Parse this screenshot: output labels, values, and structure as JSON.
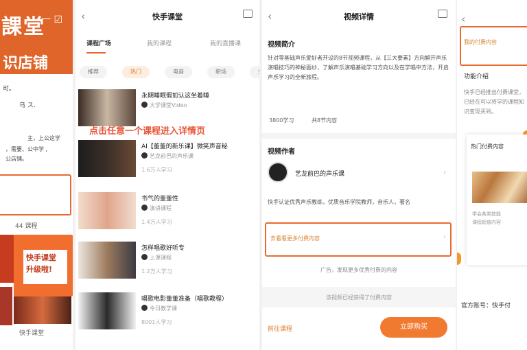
{
  "panel1": {
    "banner_title": "課堂",
    "banner_subtitle": "识店铺",
    "top_icons": "一 ☑",
    "text_lines": [
      "可。",
      "乌 ス.",
      "主，上公这学",
      "，需要、公中学 ,",
      "公店铺。"
    ],
    "count": "44 课程",
    "promo_text": "快手课堂\n升级啦!",
    "footer": "快手课堂"
  },
  "panel2": {
    "title": "快手课堂",
    "back": "‹",
    "tabs": [
      "课程广场",
      "我的课程",
      "我的直播课"
    ],
    "chips": [
      "推荐",
      "热门",
      "电商",
      "职场",
      "生活"
    ],
    "hint": "点击任意一个课程进入详情页",
    "items": [
      {
        "title": "永期睡眠假如认这坐着睡",
        "meta": "大学课堂Video",
        "count": ""
      },
      {
        "title": "AI【董董的新乐课】微笑声音秘",
        "meta": "艺龙前巴的声乐课",
        "count": "1.6万人学习"
      },
      {
        "title": "书气的董董性",
        "meta": "演讲课程",
        "count": "1.4万人学习"
      },
      {
        "title": "怎样唱歌好听专",
        "meta": "上课课程",
        "count": "1.2万人学习"
      },
      {
        "title": "唱歌电影董董准备（唱歌教程）",
        "meta": "今日教学课",
        "count": "8001人学习"
      }
    ]
  },
  "panel3": {
    "title": "视频详情",
    "back": "‹",
    "intro_heading": "视频简介",
    "intro_body": "针对零基础声乐爱好者开设的8节视频课程，从【三大要素】方向解开声乐演唱技巧的神秘面纱，了解声乐演唱基础学习方向以及在学唱中方法，开启声乐学习的全新旅程。",
    "meta_left": "3800学习",
    "meta_right": "共8节内容",
    "author_heading": "视频作者",
    "author_name": "艺龙前巴的声乐课",
    "author_desc": "快手认证优秀声乐教练，优质音乐学院教师，音乐人，著名",
    "box_text": "去看看更多付费内容",
    "hint": "广告，发现更多优秀付费的内容",
    "bar_text": "该视频已经获得了付费内容",
    "footer_left": "前往课程",
    "cta": "立即购买"
  },
  "panel4": {
    "back": "‹",
    "box_text": "我的付费内容",
    "section": "功能介绍",
    "body": "快手已经推出付费课堂，已经在可以将学的课程知识变现买到。",
    "card_title": "热门付费内容",
    "card_text": "学会各类技能\n课程超值内容",
    "footer": "官方账号：快手付"
  }
}
